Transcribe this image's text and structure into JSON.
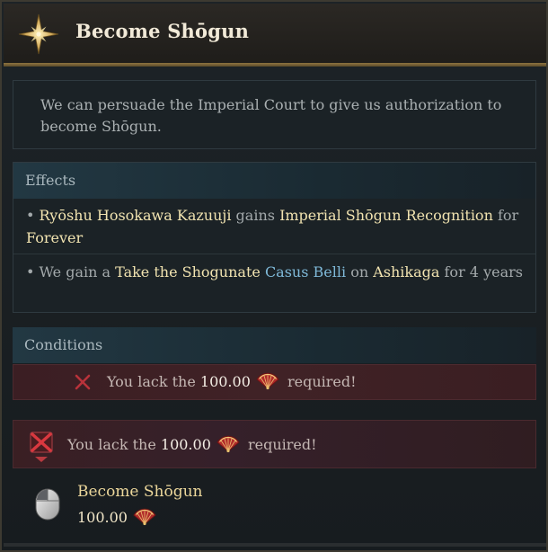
{
  "window": {
    "title": "Become Shōgun"
  },
  "description": "We can persuade the Imperial Court to give us authorization to become Shōgun.",
  "effects": {
    "header": "Effects",
    "items": [
      {
        "bullet": "•",
        "p1": "Ryōshu Hosokawa Kazuuji",
        "p2": " gains ",
        "p3": "Imperial Shōgun Recognition",
        "p4": " for ",
        "p5": "Forever"
      },
      {
        "bullet": "•",
        "p1": "We gain a ",
        "p2": "Take the Shogunate",
        "p3": "Casus Belli",
        "p4": " on ",
        "p5": "Ashikaga",
        "p6": " for 4 years"
      }
    ]
  },
  "conditions": {
    "header": "Conditions",
    "items": [
      {
        "prefix": "You lack the",
        "amount": "100.00",
        "suffix": "required!"
      }
    ]
  },
  "warning": {
    "prefix": "You lack the",
    "amount": "100.00",
    "suffix": "required!"
  },
  "action": {
    "label": "Become Shōgun",
    "cost": "100.00"
  },
  "icons": {
    "title": "gold-star-icon",
    "condition_fail": "red-cross-icon",
    "warning": "crossed-out-icon",
    "currency": "fan-currency-icon",
    "action": "mouse-left-click-icon"
  },
  "colors": {
    "accent_gold": "#f1e3b0",
    "link_blue": "#7fb9d8",
    "fail_red": "#c0333b"
  }
}
